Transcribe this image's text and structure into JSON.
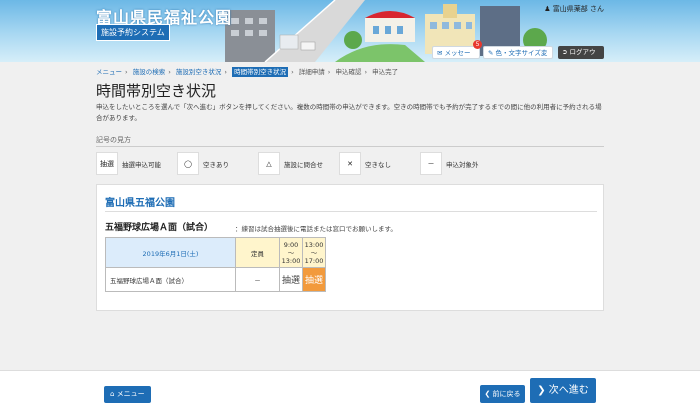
{
  "header": {
    "title": "富山県民福祉公園",
    "subtitle": "施設予約システム",
    "user": "富山県薬部 さん",
    "message_label": "メッセージ",
    "message_count": "5",
    "color_label": "色・文字サイズ変更",
    "logout_label": "ログアウト"
  },
  "breadcrumb": {
    "items": [
      "メニュー",
      "施設の検索",
      "施設別空き状況",
      "時間帯別空き状況",
      "詳細申請",
      "申込確認",
      "申込完了"
    ],
    "current_index": 3
  },
  "page": {
    "title": "時間帯別空き状況",
    "description": "申込をしたいところを選んで「次へ進む」ボタンを押してください。複数の時間帯の申込ができます。空きの時間帯でも予約が完了するまでの間に他の利用者に予約される場合があります。"
  },
  "legend": {
    "title": "記号の見方",
    "items": [
      {
        "symbol": "抽選",
        "label": "抽選申込可能",
        "icon": "lottery-icon"
      },
      {
        "symbol": "◯",
        "label": "空きあり",
        "icon": "circle-icon"
      },
      {
        "symbol": "△",
        "label": "施設に問合せ",
        "icon": "triangle-icon"
      },
      {
        "symbol": "✕",
        "label": "空きなし",
        "icon": "cross-icon"
      },
      {
        "symbol": "－",
        "label": "申込対象外",
        "icon": "dash-icon"
      }
    ]
  },
  "facility": {
    "name": "富山県五福公園",
    "court": "五福野球広場Ａ面（試合）",
    "note": "：練習は試合抽選後に電話または窓口でお願いします。",
    "date": "2019年6月1日(土)",
    "capacity_header": "定員",
    "slots": [
      {
        "start": "9:00",
        "sep": "～",
        "end": "13:00"
      },
      {
        "start": "13:00",
        "sep": "～",
        "end": "17:00"
      }
    ],
    "row_name": "五福野球広場Ａ面（試合）",
    "capacity": "－",
    "cells": [
      {
        "value": "抽選",
        "selected": false
      },
      {
        "value": "抽選",
        "selected": true
      }
    ]
  },
  "footer": {
    "menu_label": "メニュー",
    "back_label": "前に戻る",
    "next_label": "次へ進む"
  },
  "colors": {
    "primary": "#1e6db5",
    "selected": "#f29a3c",
    "header_yellow": "#fff5cc",
    "date_blue": "#dcecfb"
  }
}
